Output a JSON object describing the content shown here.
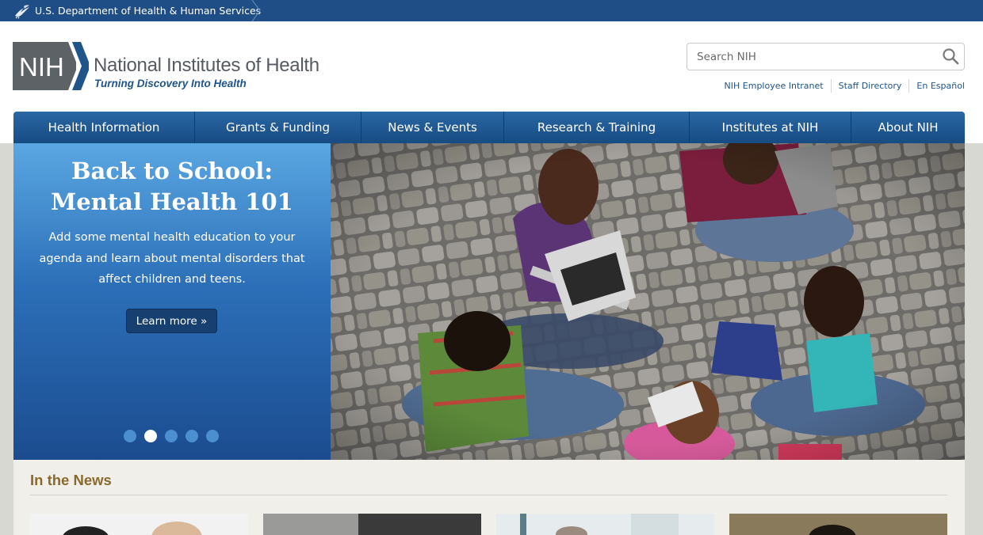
{
  "hhs_bar": {
    "label": "U.S. Department of Health & Human Services",
    "icon": "hhs-eagle-icon",
    "color": "#1f4e86"
  },
  "header": {
    "logo_badge": "NIH",
    "logo_title": "National Institutes of Health",
    "logo_tagline": "Turning Discovery Into Health",
    "search": {
      "placeholder": "Search NIH",
      "value": "",
      "icon": "search-icon"
    },
    "utility_links": [
      {
        "label": "NIH Employee Intranet"
      },
      {
        "label": "Staff Directory"
      },
      {
        "label": "En Español"
      }
    ]
  },
  "nav": {
    "items": [
      {
        "label": "Health Information"
      },
      {
        "label": "Grants & Funding"
      },
      {
        "label": "News & Events"
      },
      {
        "label": "Research & Training"
      },
      {
        "label": "Institutes at NIH"
      },
      {
        "label": "About NIH"
      }
    ],
    "color": "#1f5a96"
  },
  "hero": {
    "title_line1": "Back to School:",
    "title_line2": "Mental Health 101",
    "text": "Add some mental health education to your agenda and learn about mental disorders that affect children and teens.",
    "button_label": "Learn more »",
    "slides_count": 5,
    "active_slide": 2
  },
  "news": {
    "heading": "In the News",
    "heading_color": "#8a6a2c"
  }
}
